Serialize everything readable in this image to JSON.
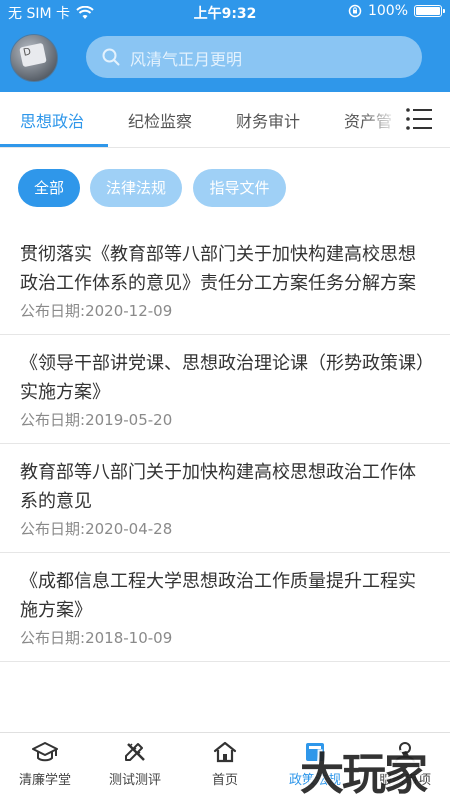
{
  "status_bar": {
    "carrier": "无 SIM 卡",
    "time": "上午9:32",
    "battery": "100%"
  },
  "header": {
    "search_placeholder": "风清气正月更明"
  },
  "tabs": [
    {
      "label": "思想政治",
      "active": true
    },
    {
      "label": "纪检监察",
      "active": false
    },
    {
      "label": "财务审计",
      "active": false
    },
    {
      "label": "资产管",
      "active": false
    }
  ],
  "filters": [
    {
      "label": "全部",
      "active": true
    },
    {
      "label": "法律法规",
      "active": false
    },
    {
      "label": "指导文件",
      "active": false
    }
  ],
  "date_prefix": "公布日期:",
  "articles": [
    {
      "title": "贯彻落实《教育部等八部门关于加快构建高校思想政治工作体系的意见》责任分工方案任务分解方案",
      "date": "2020-12-09"
    },
    {
      "title": "《领导干部讲党课、思想政治理论课（形势政策课）实施方案》",
      "date": "2019-05-20"
    },
    {
      "title": "教育部等八部门关于加快构建高校思想政治工作体系的意见",
      "date": "2020-04-28"
    },
    {
      "title": "《成都信息工程大学思想政治工作质量提升工程实施方案》",
      "date": "2018-10-09"
    }
  ],
  "bottom_nav": [
    {
      "label": "清廉学堂",
      "icon": "graduation-cap-icon",
      "active": false
    },
    {
      "label": "测试测评",
      "icon": "pencil-ruler-icon",
      "active": false
    },
    {
      "label": "首页",
      "icon": "home-icon",
      "active": false
    },
    {
      "label": "政策法规",
      "icon": "book-icon",
      "active": true
    },
    {
      "label": "服务事项",
      "icon": "user-icon",
      "active": false
    }
  ],
  "watermark": "大玩家",
  "colors": {
    "accent": "#2f97ea",
    "chip_inactive": "#9fd0f6",
    "search_bg": "#8ac5f3"
  }
}
